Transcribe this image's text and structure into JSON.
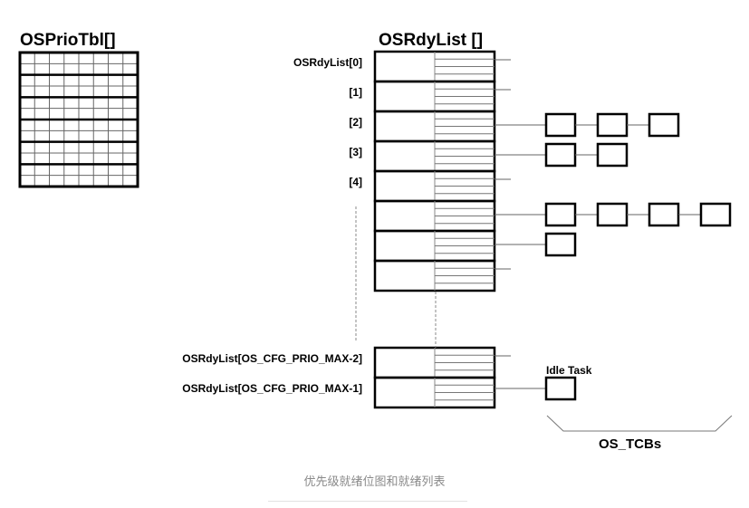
{
  "prio_table": {
    "title": "OSPrioTbl[]",
    "rows": 6,
    "cols": 8
  },
  "ready_list": {
    "title": "OSRdyList []",
    "entries": [
      {
        "label": "OSRdyList[0]",
        "tcbs": 0
      },
      {
        "label": "[1]",
        "tcbs": 0
      },
      {
        "label": "[2]",
        "tcbs": 3
      },
      {
        "label": "[3]",
        "tcbs": 2
      },
      {
        "label": "[4]",
        "tcbs": 0
      },
      {
        "label": "",
        "tcbs": 4
      },
      {
        "label": "",
        "tcbs": 1
      },
      {
        "label": "",
        "tcbs": 0
      }
    ],
    "tail_entries": [
      {
        "label": "OSRdyList[OS_CFG_PRIO_MAX-2]",
        "tcbs": 0
      },
      {
        "label": "OSRdyList[OS_CFG_PRIO_MAX-1]",
        "tcbs": 1
      }
    ]
  },
  "idle_task_label": "Idle Task",
  "tcbs_label": "OS_TCBs",
  "caption": "优先级就绪位图和就绪列表",
  "colors": {
    "line": "#000000",
    "thin": "#555555",
    "caption": "#8a8a8a"
  }
}
